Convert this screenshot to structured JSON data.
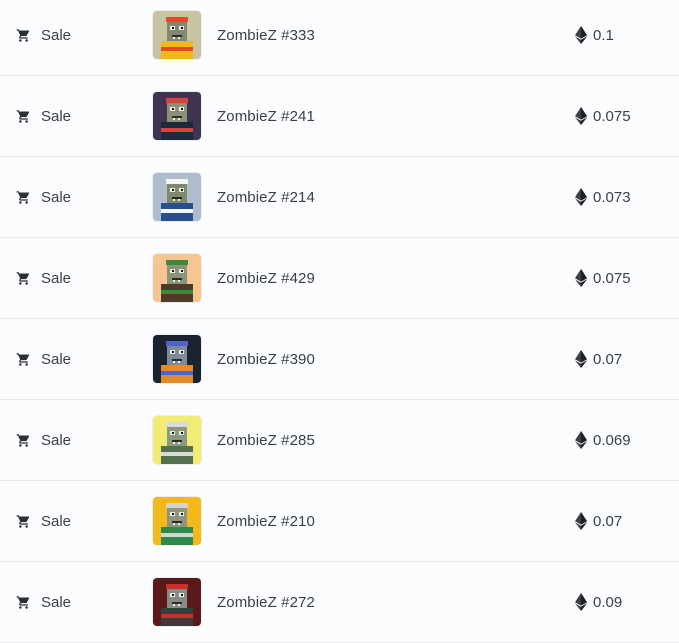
{
  "rows": [
    {
      "event": "Sale",
      "event_icon": "cart-icon",
      "name": "ZombieZ #333",
      "price": "0.1",
      "currency_icon": "ethereum-icon",
      "thumb_bg": "#c9c3a2",
      "accent": "#e8462b",
      "shirt": "#f1b81e",
      "face": "#7f8a70"
    },
    {
      "event": "Sale",
      "event_icon": "cart-icon",
      "name": "ZombieZ #241",
      "price": "0.075",
      "currency_icon": "ethereum-icon",
      "thumb_bg": "#3f3452",
      "accent": "#d6453a",
      "shirt": "#1e2a3c",
      "face": "#8c9076"
    },
    {
      "event": "Sale",
      "event_icon": "cart-icon",
      "name": "ZombieZ #214",
      "price": "0.073",
      "currency_icon": "ethereum-icon",
      "thumb_bg": "#aebccc",
      "accent": "#f4f4f4",
      "shirt": "#2a4f8f",
      "face": "#7e8a6e"
    },
    {
      "event": "Sale",
      "event_icon": "cart-icon",
      "name": "ZombieZ #429",
      "price": "0.075",
      "currency_icon": "ethereum-icon",
      "thumb_bg": "#f6c592",
      "accent": "#3f8a3a",
      "shirt": "#4d3a28",
      "face": "#8a9478"
    },
    {
      "event": "Sale",
      "event_icon": "cart-icon",
      "name": "ZombieZ #390",
      "price": "0.07",
      "currency_icon": "ethereum-icon",
      "thumb_bg": "#1b2230",
      "accent": "#4f63c8",
      "shirt": "#e38a2a",
      "face": "#7f8b9a"
    },
    {
      "event": "Sale",
      "event_icon": "cart-icon",
      "name": "ZombieZ #285",
      "price": "0.069",
      "currency_icon": "ethereum-icon",
      "thumb_bg": "#f2ec74",
      "accent": "#dadada",
      "shirt": "#56704e",
      "face": "#8a9a80"
    },
    {
      "event": "Sale",
      "event_icon": "cart-icon",
      "name": "ZombieZ #210",
      "price": "0.07",
      "currency_icon": "ethereum-icon",
      "thumb_bg": "#f3b81c",
      "accent": "#d4d4d4",
      "shirt": "#2f8a4a",
      "face": "#8e9680"
    },
    {
      "event": "Sale",
      "event_icon": "cart-icon",
      "name": "ZombieZ #272",
      "price": "0.09",
      "currency_icon": "ethereum-icon",
      "thumb_bg": "#5a1a1a",
      "accent": "#c9302c",
      "shirt": "#3b3b3b",
      "face": "#8a8a86"
    }
  ]
}
